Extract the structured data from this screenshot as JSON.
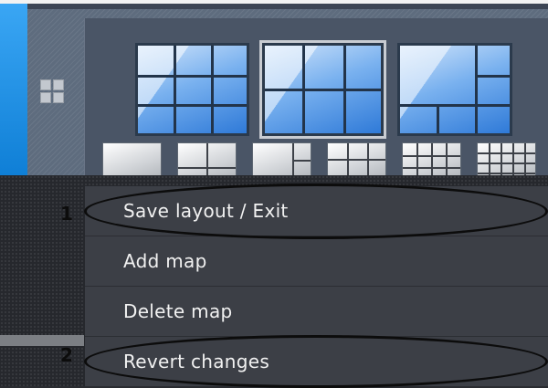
{
  "toolbar": {
    "grid_icon": "grid-icon",
    "menu_icon": "layout-menu-icon"
  },
  "layout_panel": {
    "big_layouts": [
      {
        "name": "3x3 layout",
        "selected": false
      },
      {
        "name": "2x2 layout",
        "selected": true
      },
      {
        "name": "1+5 layout",
        "selected": false
      }
    ],
    "small_layouts": [
      "1x1",
      "2x2",
      "1+7",
      "3x3",
      "4x4",
      "5x5"
    ]
  },
  "context_menu": {
    "items": [
      {
        "label": "Save layout / Exit",
        "annotated": true
      },
      {
        "label": "Add map",
        "annotated": false
      },
      {
        "label": "Delete map",
        "annotated": false
      },
      {
        "label": "Revert changes",
        "annotated": true
      }
    ]
  },
  "annotations": [
    "1",
    "2"
  ],
  "colors": {
    "accent_blue": "#1d8fe6",
    "menu_bg": "#3c3f46",
    "menu_text": "#f1f1f1",
    "callout": "#0c0c0c"
  }
}
